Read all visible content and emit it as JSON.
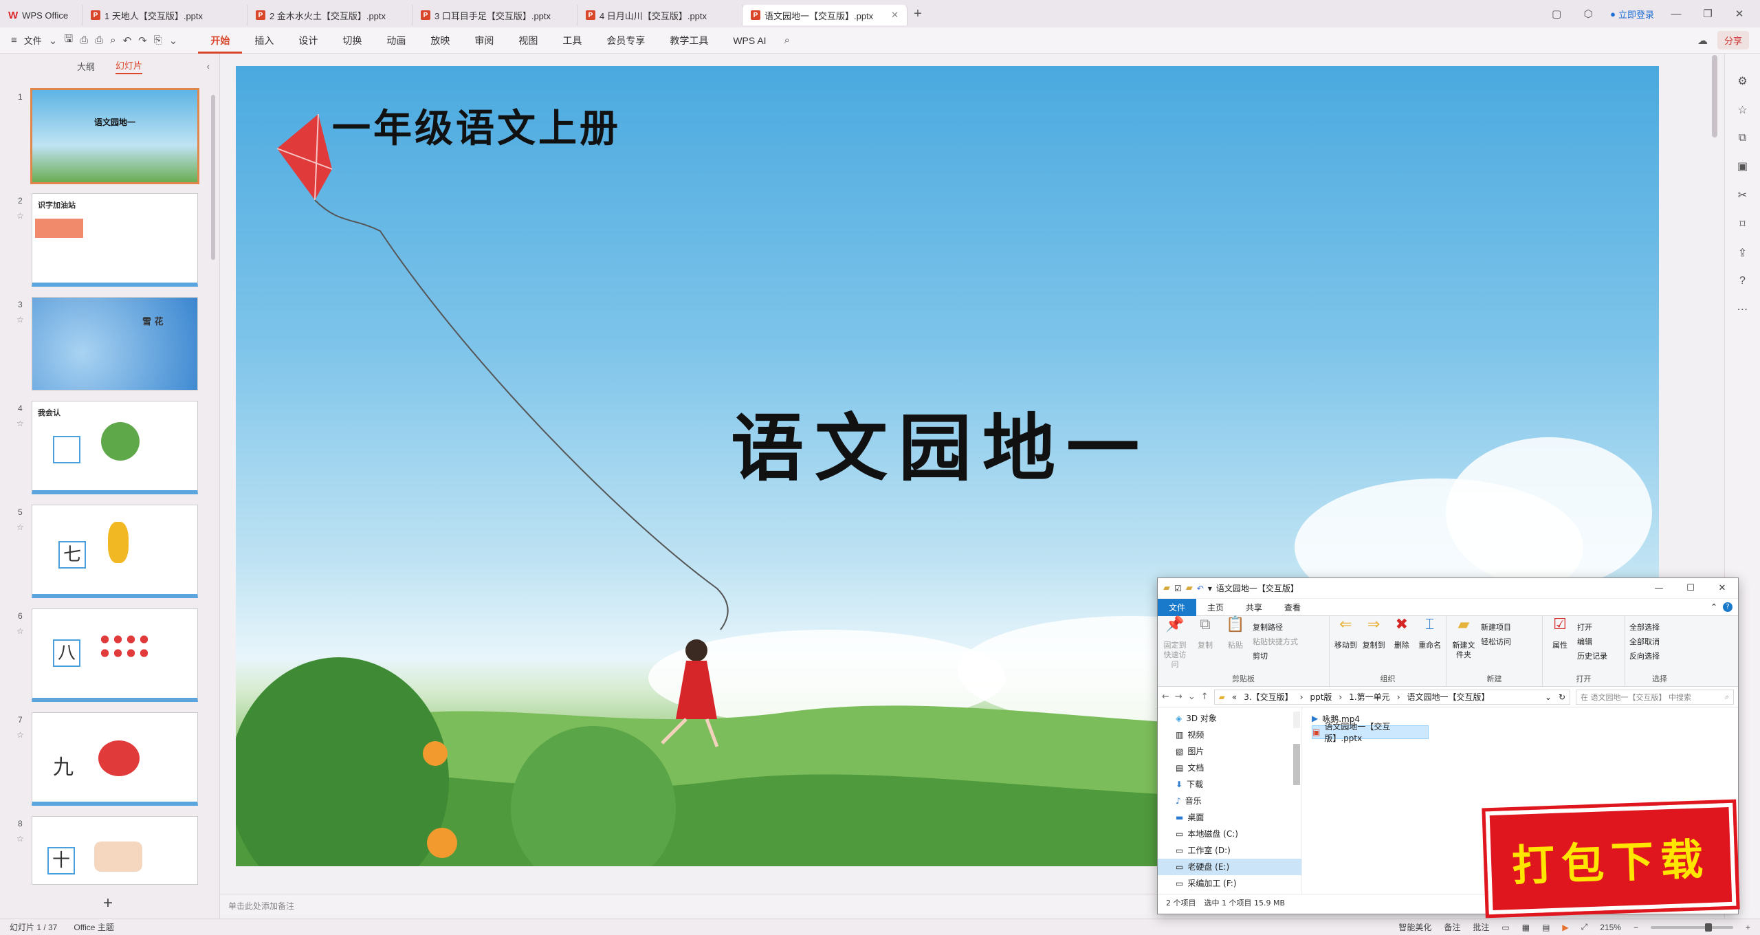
{
  "titlebar": {
    "home_tab": "WPS Office",
    "tabs": [
      {
        "label": "1 天地人【交互版】.pptx"
      },
      {
        "label": "2 金木水火土【交互版】.pptx"
      },
      {
        "label": "3 口耳目手足【交互版】.pptx"
      },
      {
        "label": "4 日月山川【交互版】.pptx"
      },
      {
        "label": "语文园地一【交互版】.pptx"
      }
    ],
    "login": "立即登录"
  },
  "menubar": {
    "file": "文件",
    "tabs": [
      "开始",
      "插入",
      "设计",
      "切换",
      "动画",
      "放映",
      "审阅",
      "视图",
      "工具",
      "会员专享",
      "教学工具",
      "WPS AI"
    ],
    "active_tab": "开始",
    "share": "分享"
  },
  "leftpanel": {
    "tab_outline": "大纲",
    "tab_slides": "幻灯片",
    "thumbs": [
      {
        "num": "1",
        "text": "语文园地一"
      },
      {
        "num": "2",
        "text": "识字加油站"
      },
      {
        "num": "3",
        "text": "雪 花"
      },
      {
        "num": "4",
        "text": "我会认"
      },
      {
        "num": "5",
        "text": "七"
      },
      {
        "num": "6",
        "text": "八"
      },
      {
        "num": "7",
        "text": "九"
      },
      {
        "num": "8",
        "text": "十"
      }
    ]
  },
  "slide": {
    "small_title": "一年级语文上册",
    "main_title": "语文园地一"
  },
  "notes": {
    "placeholder": "单击此处添加备注"
  },
  "statusbar": {
    "slide_count": "幻灯片 1 / 37",
    "theme": "Office 主题",
    "smart": "智能美化",
    "notes": "备注",
    "comments": "批注",
    "zoom": "215%",
    "zoom_level": 0.72
  },
  "explorer": {
    "title": "语文园地一【交互版】",
    "tabs": [
      "文件",
      "主页",
      "共享",
      "查看"
    ],
    "ribbon": {
      "clipboard": {
        "pin": "固定到快速访问",
        "copy": "复制",
        "paste": "粘贴",
        "copy_path": "复制路径",
        "paste_shortcut": "粘贴快捷方式",
        "cut": "剪切",
        "label": "剪贴板"
      },
      "organize": {
        "move": "移动到",
        "copy_to": "复制到",
        "delete": "删除",
        "rename": "重命名",
        "label": "组织"
      },
      "new": {
        "new_folder": "新建文件夹",
        "new_item": "新建项目",
        "easy_access": "轻松访问",
        "label": "新建"
      },
      "open": {
        "properties": "属性",
        "open": "打开",
        "edit": "编辑",
        "history": "历史记录",
        "label": "打开"
      },
      "select": {
        "all": "全部选择",
        "none": "全部取消",
        "invert": "反向选择",
        "label": "选择"
      }
    },
    "path": [
      "3.【交互版】",
      "ppt版",
      "1.第一单元",
      "语文园地一【交互版】"
    ],
    "search_placeholder": "在 语文园地一【交互版】 中搜索",
    "tree": [
      "3D 对象",
      "视频",
      "图片",
      "文档",
      "下载",
      "音乐",
      "桌面",
      "本地磁盘 (C:)",
      "工作室 (D:)",
      "老硬盘 (E:)",
      "采编加工 (F:)"
    ],
    "files": [
      {
        "name": "咏鹅.mp4"
      },
      {
        "name": "语文园地一【交互版】.pptx"
      }
    ],
    "status": {
      "count": "2 个项目",
      "selected": "选中 1 个项目 15.9 MB"
    }
  },
  "stamp": {
    "text": "打包下载"
  },
  "colors": {
    "accent": "#d9462a",
    "explorer_blue": "#1979ca",
    "stamp_red": "#e0161e",
    "stamp_yellow": "#ffe600"
  }
}
